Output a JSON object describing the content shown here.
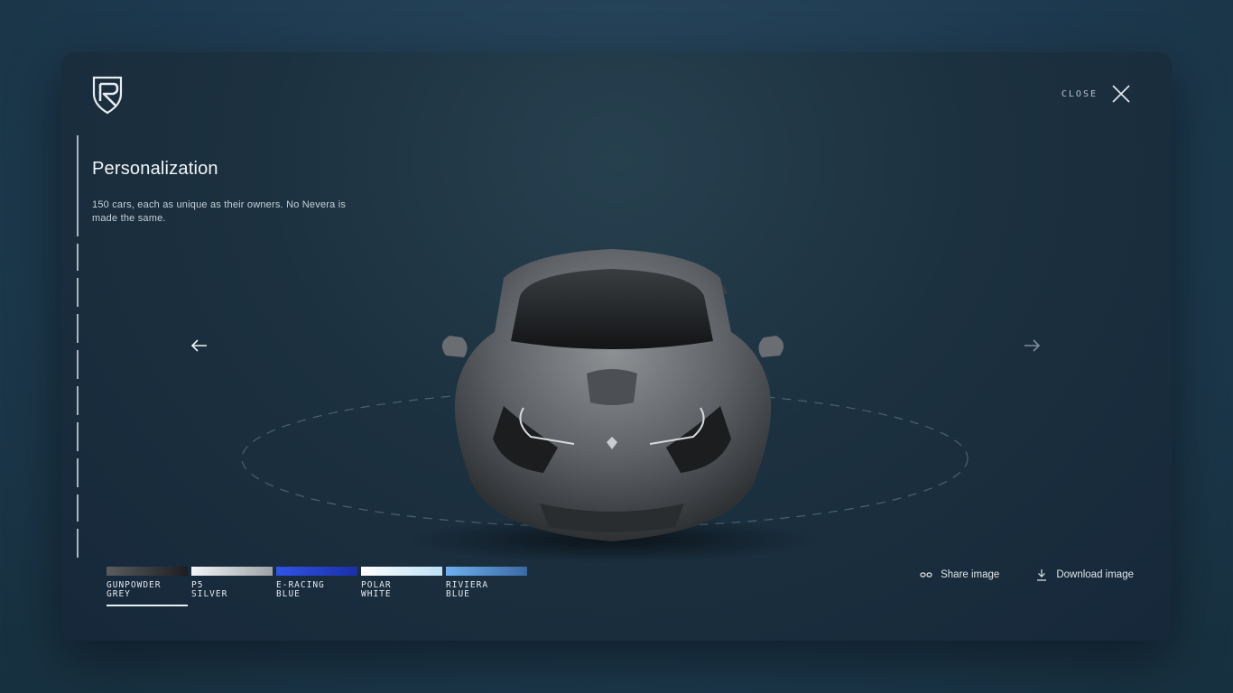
{
  "header": {
    "close_label": "CLOSE"
  },
  "section": {
    "title": "Personalization",
    "description": "150 cars, each as unique as their owners. No Nevera is made the same."
  },
  "colors": {
    "accent": "#e8eef2",
    "background": "#1e3a50"
  },
  "swatches": [
    {
      "line1": "GUNPOWDER",
      "line2": "GREY",
      "color_from": "#5a5c5e",
      "color_to": "#1c1d1f",
      "active": true
    },
    {
      "line1": "P5",
      "line2": "SILVER",
      "color_from": "#f4f5f6",
      "color_to": "#9ea3a7",
      "active": false
    },
    {
      "line1": "E-RACING",
      "line2": "BLUE",
      "color_from": "#2f55e6",
      "color_to": "#1a2fa8",
      "active": false
    },
    {
      "line1": "POLAR",
      "line2": "WHITE",
      "color_from": "#ffffff",
      "color_to": "#bfe0f5",
      "active": false
    },
    {
      "line1": "RIVIERA",
      "line2": "BLUE",
      "color_from": "#6fb0ee",
      "color_to": "#3a6aa3",
      "active": false
    }
  ],
  "actions": {
    "share_label": "Share image",
    "download_label": "Download image"
  },
  "icons": [
    "rimac-logo",
    "close-icon",
    "arrow-left-icon",
    "arrow-right-icon",
    "link-icon",
    "download-icon"
  ]
}
